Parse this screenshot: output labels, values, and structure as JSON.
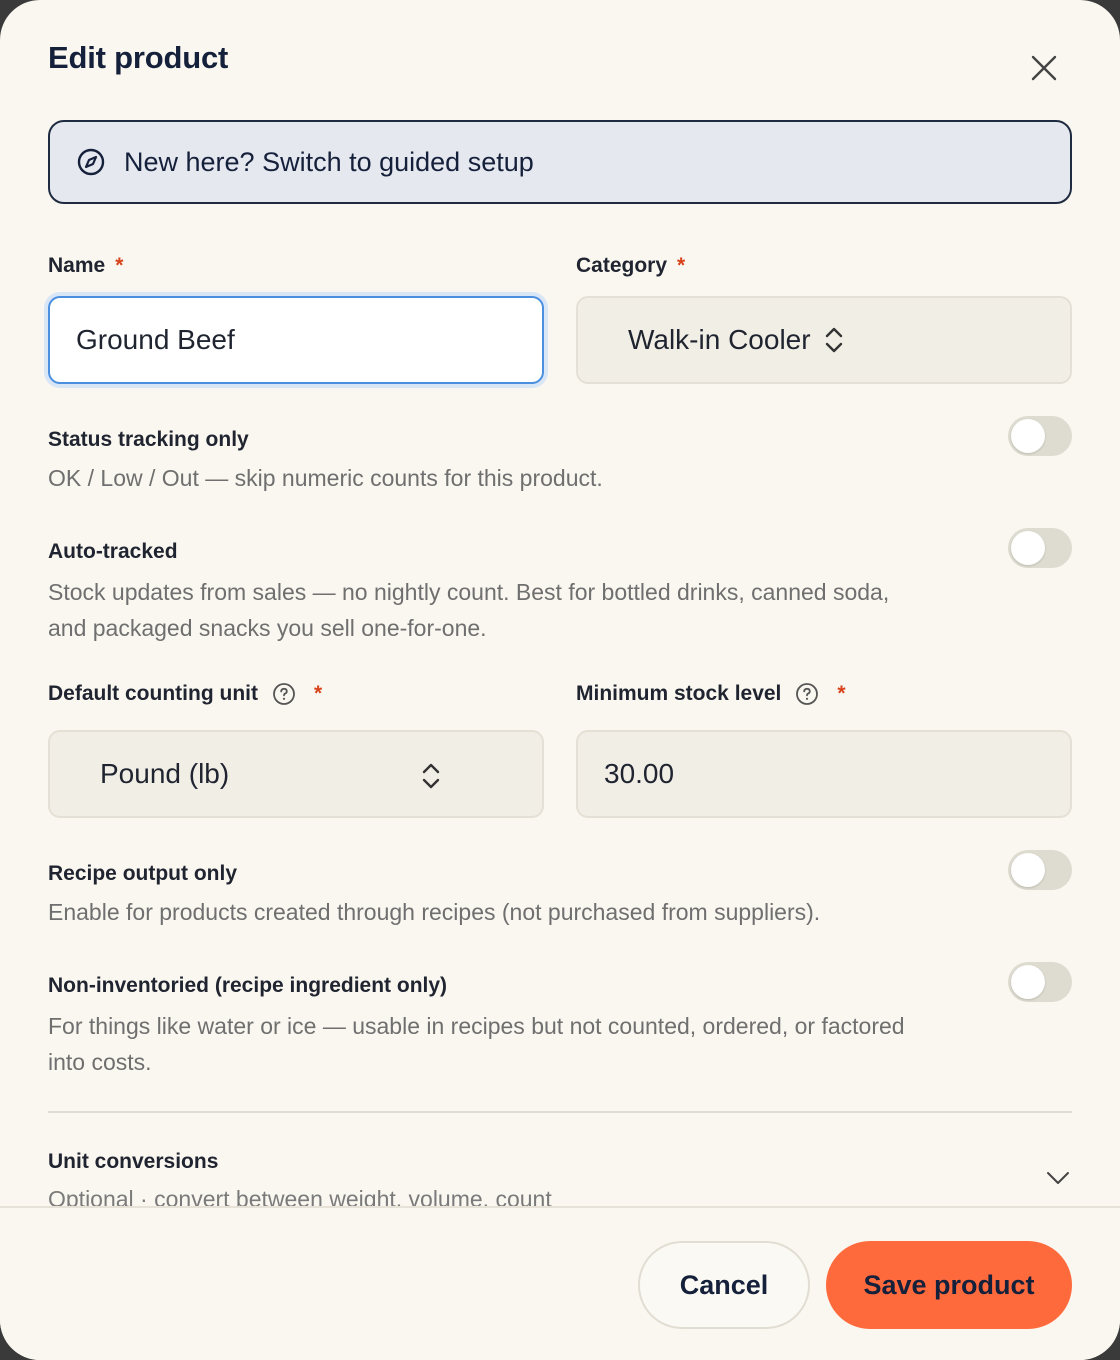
{
  "dialog": {
    "title": "Edit product",
    "banner_text": "New here? Switch to guided setup"
  },
  "name_field": {
    "label": "Name",
    "required_mark": "*",
    "value": "Ground Beef"
  },
  "category_field": {
    "label": "Category",
    "required_mark": "*",
    "value": "Walk-in Cooler"
  },
  "toggles": [
    {
      "title": "Status tracking only",
      "description": "OK / Low / Out — skip numeric counts for this product.",
      "enabled": false
    },
    {
      "title": "Auto-tracked",
      "description": "Stock updates from sales — no nightly count. Best for bottled drinks, canned soda, and packaged snacks you sell one-for-one.",
      "enabled": false
    },
    {
      "title": "Recipe output only",
      "description": "Enable for products created through recipes (not purchased from suppliers).",
      "enabled": false
    },
    {
      "title": "Non-inventoried (recipe ingredient only)",
      "description": "For things like water or ice — usable in recipes but not counted, ordered, or factored into costs.",
      "enabled": false
    }
  ],
  "unit_field": {
    "label": "Default counting unit",
    "required_mark": "*",
    "value": "Pound (lb)"
  },
  "min_stock_field": {
    "label": "Minimum stock level",
    "required_mark": "*",
    "value": "30.00"
  },
  "unit_conversions": {
    "title": "Unit conversions",
    "description": "Optional · convert between weight, volume, count"
  },
  "footer": {
    "cancel_label": "Cancel",
    "save_label": "Save product"
  },
  "colors": {
    "accent": "#ff6a3d",
    "required": "#d8431b",
    "focus_border": "#4a8fe0"
  }
}
